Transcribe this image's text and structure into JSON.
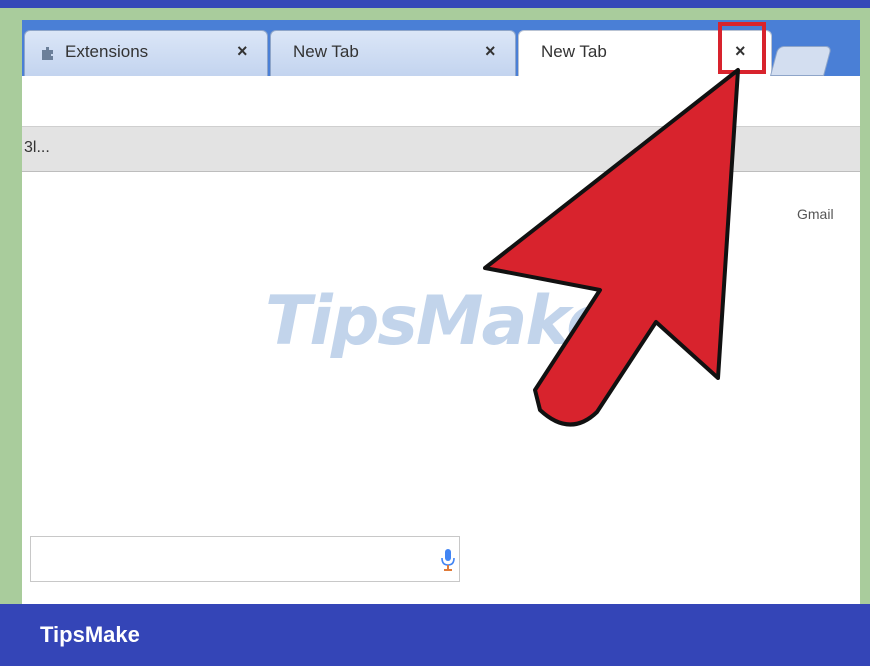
{
  "tabs": [
    {
      "label": "Extensions",
      "icon": "puzzle-piece-icon",
      "close": "×"
    },
    {
      "label": "New Tab",
      "close": "×"
    },
    {
      "label": "New Tab",
      "close": "×",
      "active": true
    }
  ],
  "bookmarks_bar": {
    "item": "3l..."
  },
  "page": {
    "gmail_link": "Gmail"
  },
  "footer": {
    "brand": "TipsMake"
  },
  "watermark": {
    "text": "TipsMake"
  },
  "colors": {
    "arrow": "#d8232d",
    "highlight": "#d8232d",
    "footer": "#3445b7",
    "frame": "#a9cc9c"
  }
}
